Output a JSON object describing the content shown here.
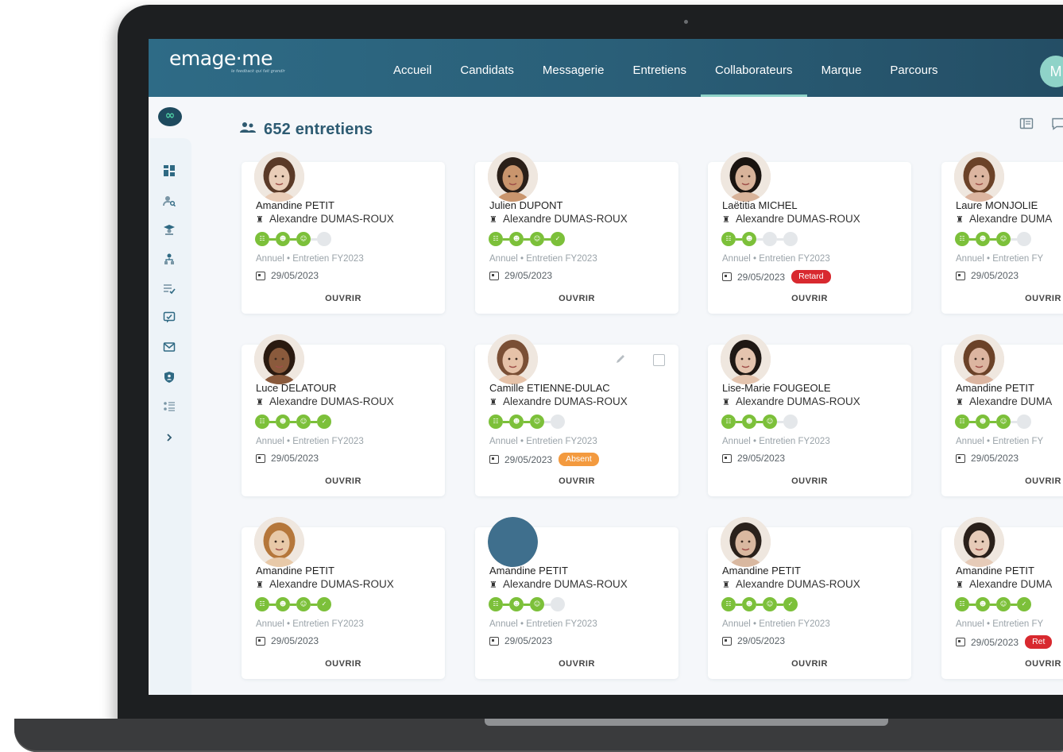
{
  "app": {
    "brand": "emage·me",
    "tagline": "le feedback qui fait grandir",
    "user_initial": "M"
  },
  "nav": {
    "items": [
      "Accueil",
      "Candidats",
      "Messagerie",
      "Entretiens",
      "Collaborateurs",
      "Marque",
      "Parcours"
    ],
    "active": "Collaborateurs"
  },
  "sidebar": {
    "icons": [
      "dashboard-icon",
      "candidate-search-icon",
      "graduate-icon",
      "hierarchy-icon",
      "checklist-icon",
      "review-icon",
      "mail-icon",
      "shield-user-icon",
      "list-settings-icon",
      "chevron-right-icon"
    ]
  },
  "main": {
    "title": "652 entretiens"
  },
  "colors": {
    "topbar": "#2a5f78",
    "accent": "#8fd3c8",
    "step_done": "#7cc03a",
    "retard": "#d8292f",
    "absent": "#f39a3f"
  },
  "cards": [
    {
      "name": "Amandine PETIT",
      "manager": "Alexandre DUMAS-ROUX",
      "steps_done": 3,
      "meta": "Annuel  •  Entretien FY2023",
      "date": "29/05/2023",
      "badge": "",
      "open": "OUVRIR"
    },
    {
      "name": "Julien DUPONT",
      "manager": "Alexandre DUMAS-ROUX",
      "steps_done": 4,
      "meta": "Annuel  •  Entretien FY2023",
      "date": "29/05/2023",
      "badge": "",
      "open": "OUVRIR"
    },
    {
      "name": "Laëtitia MICHEL",
      "manager": "Alexandre DUMAS-ROUX",
      "steps_done": 2,
      "meta": "Annuel  •  Entretien FY2023",
      "date": "29/05/2023",
      "badge": "Retard",
      "open": "OUVRIR"
    },
    {
      "name": "Laure MONJOLIE",
      "manager": "Alexandre DUMA",
      "steps_done": 3,
      "meta": "Annuel  •  Entretien FY",
      "date": "29/05/2023",
      "badge": "",
      "open": "OUVRIR"
    },
    {
      "name": "Luce DELATOUR",
      "manager": "Alexandre DUMAS-ROUX",
      "steps_done": 4,
      "meta": "Annuel  •  Entretien FY2023",
      "date": "29/05/2023",
      "badge": "",
      "open": "OUVRIR"
    },
    {
      "name": "Camille ETIENNE-DULAC",
      "manager": "Alexandre DUMAS-ROUX",
      "steps_done": 3,
      "meta": "Annuel  •  Entretien FY2023",
      "date": "29/05/2023",
      "badge": "Absent",
      "open": "OUVRIR"
    },
    {
      "name": "Lise-Marie FOUGEOLE",
      "manager": "Alexandre DUMAS-ROUX",
      "steps_done": 3,
      "meta": "Annuel  •  Entretien FY2023",
      "date": "29/05/2023",
      "badge": "",
      "open": "OUVRIR"
    },
    {
      "name": "Amandine PETIT",
      "manager": "Alexandre DUMA",
      "steps_done": 3,
      "meta": "Annuel  •  Entretien FY",
      "date": "29/05/2023",
      "badge": "",
      "open": "OUVRIR"
    },
    {
      "name": "Amandine PETIT",
      "manager": "Alexandre DUMAS-ROUX",
      "steps_done": 4,
      "meta": "Annuel  •  Entretien FY2023",
      "date": "29/05/2023",
      "badge": "",
      "open": "OUVRIR"
    },
    {
      "name": "Amandine PETIT",
      "manager": "Alexandre DUMAS-ROUX",
      "steps_done": 3,
      "meta": "Annuel  •  Entretien FY2023",
      "date": "29/05/2023",
      "badge": "",
      "open": "OUVRIR"
    },
    {
      "name": "Amandine PETIT",
      "manager": "Alexandre DUMAS-ROUX",
      "steps_done": 4,
      "meta": "Annuel  •  Entretien FY2023",
      "date": "29/05/2023",
      "badge": "",
      "open": "OUVRIR"
    },
    {
      "name": "Amandine PETIT",
      "manager": "Alexandre DUMA",
      "steps_done": 4,
      "meta": "Annuel  •  Entretien FY",
      "date": "29/05/2023",
      "badge": "Ret",
      "open": "OUVRIR"
    }
  ]
}
